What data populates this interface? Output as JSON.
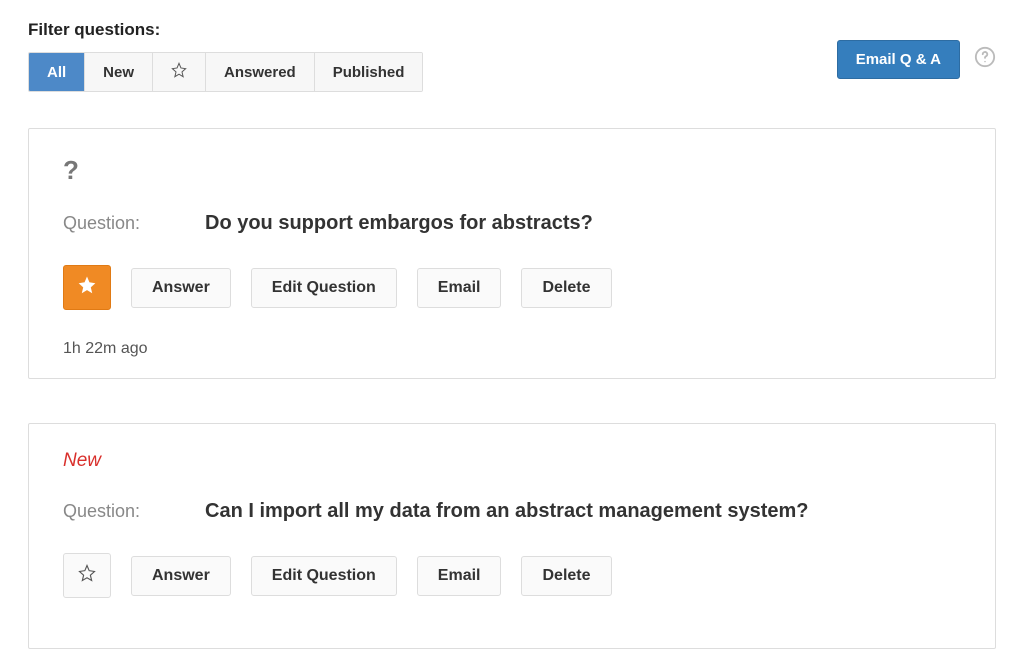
{
  "filter": {
    "label": "Filter questions:",
    "tabs": {
      "all": "All",
      "new": "New",
      "star": "star-icon",
      "answered": "Answered",
      "published": "Published"
    }
  },
  "header": {
    "email_btn": "Email Q & A",
    "help_icon": "help-icon"
  },
  "questions": [
    {
      "badge": "?",
      "badge_type": "default",
      "question_label": "Question:",
      "question_text": "Do you support embargos for abstracts?",
      "starred": true,
      "actions": {
        "answer": "Answer",
        "edit": "Edit Question",
        "email": "Email",
        "delete": "Delete"
      },
      "timestamp": "1h 22m ago"
    },
    {
      "badge": "New",
      "badge_type": "new",
      "question_label": "Question:",
      "question_text": "Can I import all my data from an abstract management system?",
      "starred": false,
      "actions": {
        "answer": "Answer",
        "edit": "Edit Question",
        "email": "Email",
        "delete": "Delete"
      },
      "timestamp": ""
    }
  ]
}
